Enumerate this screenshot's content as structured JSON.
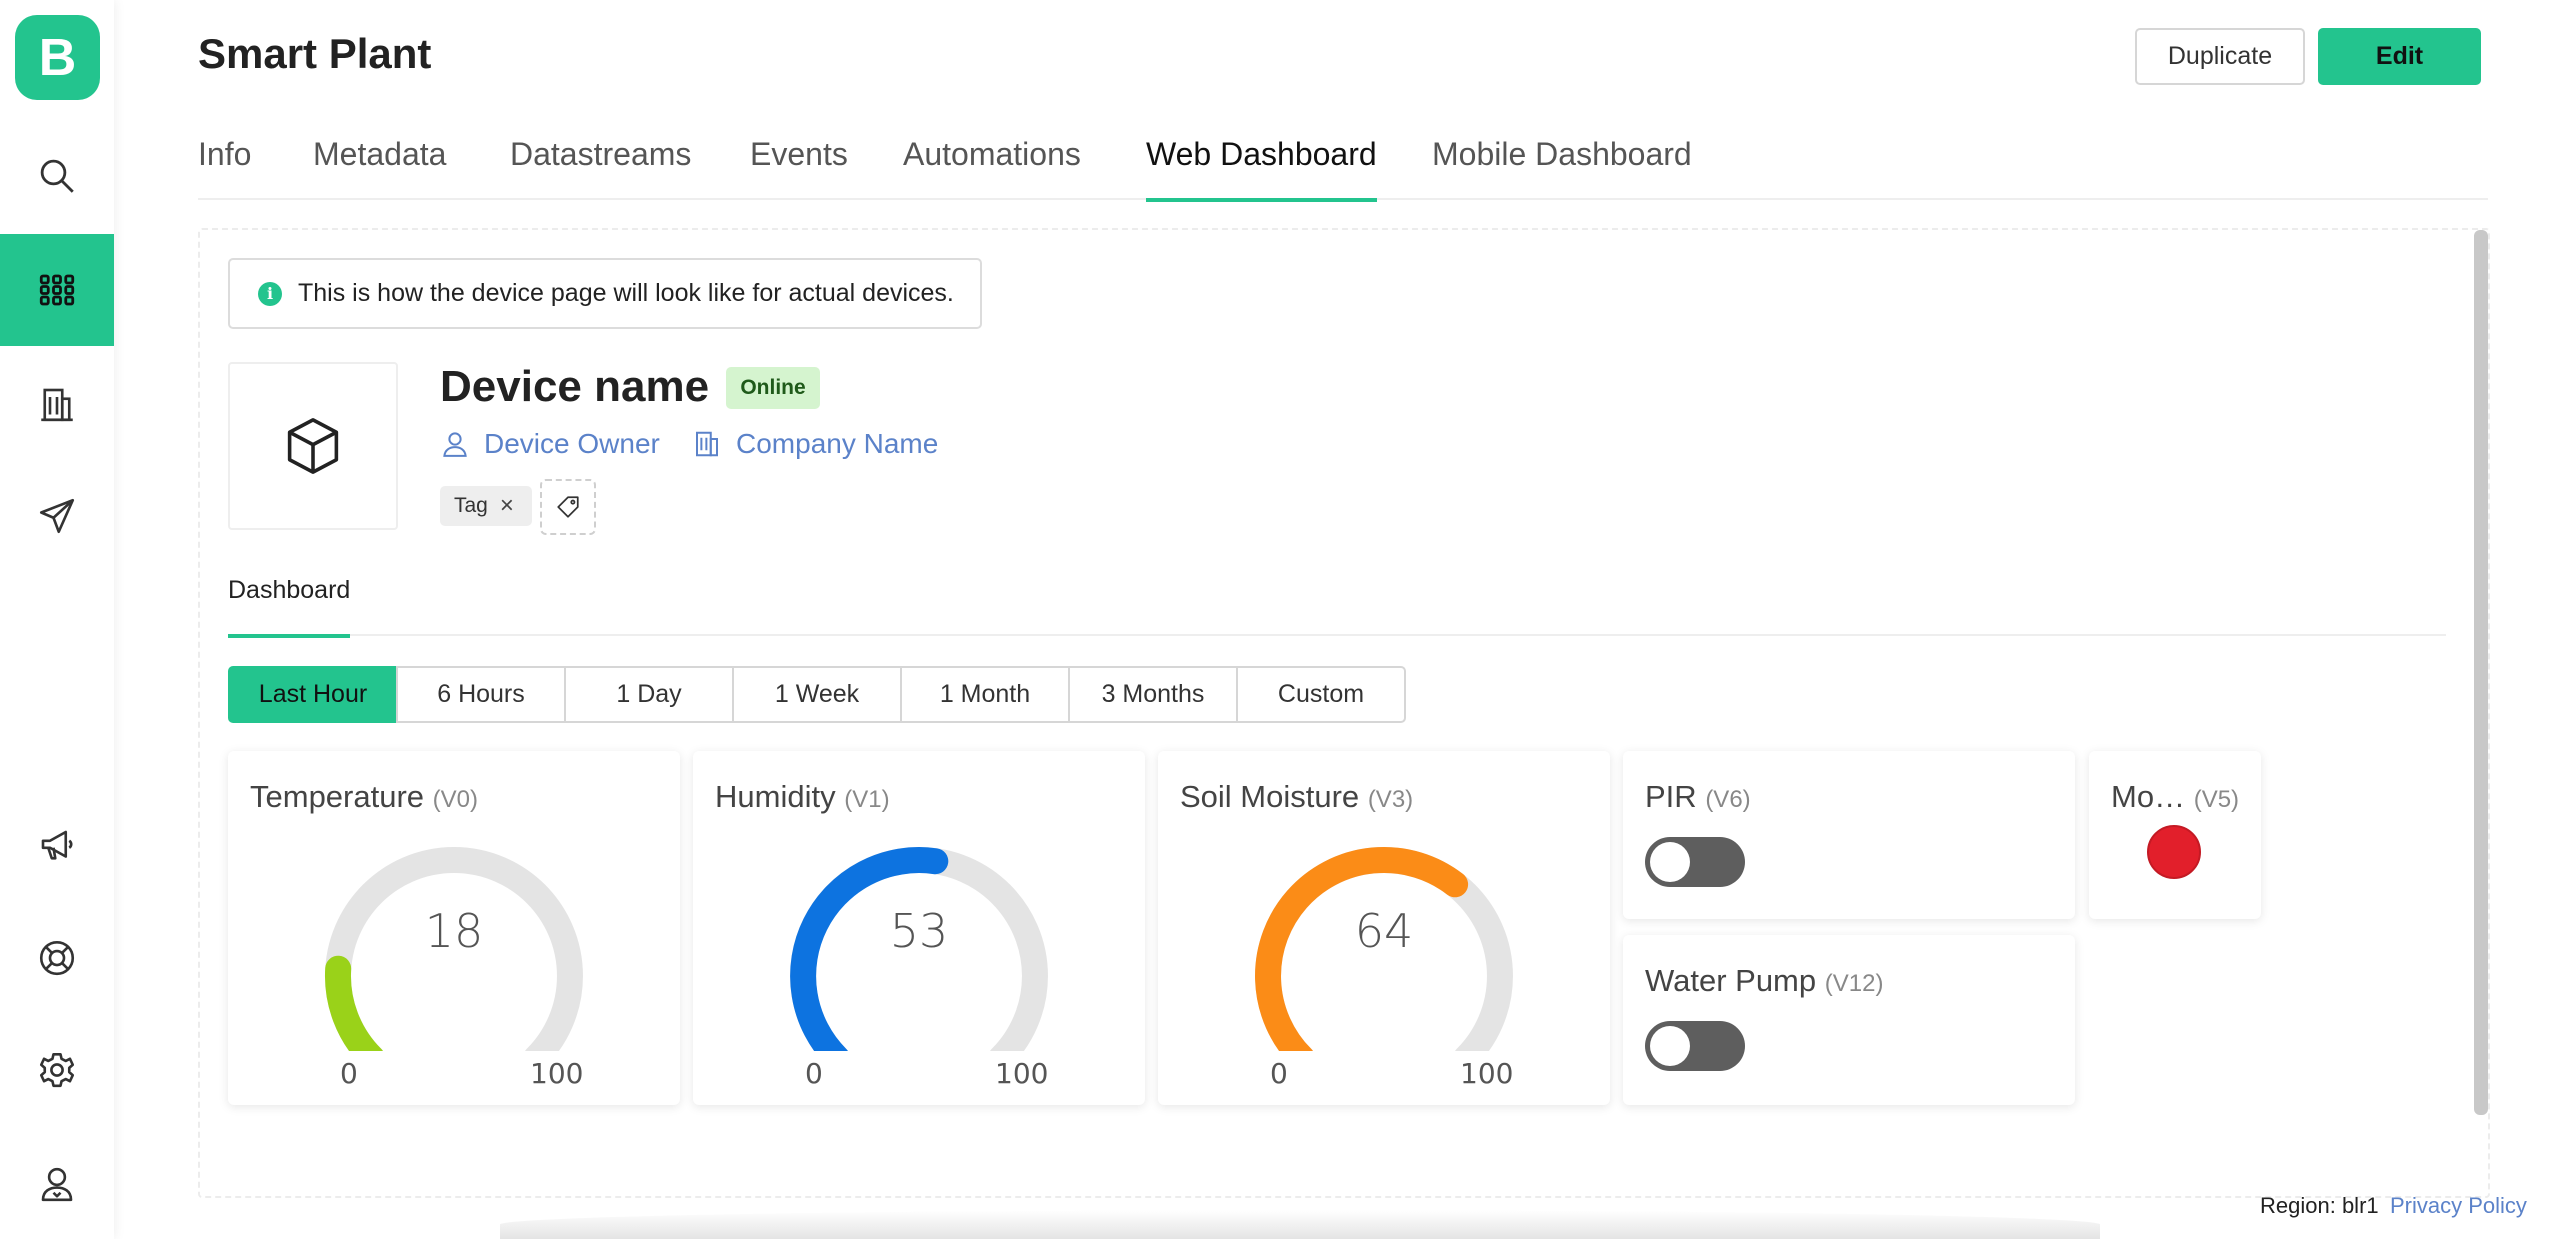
{
  "app": {
    "logo_letter": "B"
  },
  "header": {
    "title": "Smart Plant",
    "duplicate_label": "Duplicate",
    "edit_label": "Edit"
  },
  "tabs": [
    {
      "label": "Info"
    },
    {
      "label": "Metadata"
    },
    {
      "label": "Datastreams"
    },
    {
      "label": "Events"
    },
    {
      "label": "Automations"
    },
    {
      "label": "Web Dashboard",
      "active": true
    },
    {
      "label": "Mobile Dashboard"
    }
  ],
  "notice": {
    "icon": "info-icon",
    "glyph": "i",
    "text": "This is how the device page will look like for actual devices."
  },
  "device": {
    "name": "Device name",
    "status": "Online",
    "owner": "Device Owner",
    "company": "Company Name",
    "tag": "Tag",
    "tag_remove": "×"
  },
  "dashboard_tab": "Dashboard",
  "time_ranges": [
    {
      "label": "Last Hour",
      "active": true
    },
    {
      "label": "6 Hours"
    },
    {
      "label": "1 Day"
    },
    {
      "label": "1 Week"
    },
    {
      "label": "1 Month"
    },
    {
      "label": "3 Months"
    },
    {
      "label": "Custom"
    }
  ],
  "widgets": {
    "temperature": {
      "title": "Temperature",
      "pin": "(V0)",
      "value": 18,
      "min": 0,
      "max": 100,
      "color": "#9ad219"
    },
    "humidity": {
      "title": "Humidity",
      "pin": "(V1)",
      "value": 53,
      "min": 0,
      "max": 100,
      "color": "#0d73e0"
    },
    "soil": {
      "title": "Soil Moisture",
      "pin": "(V3)",
      "value": 64,
      "min": 0,
      "max": 100,
      "color": "#fb8c17"
    },
    "pir": {
      "title": "PIR",
      "pin": "(V6)",
      "state": "off"
    },
    "pump": {
      "title": "Water Pump",
      "pin": "(V12)",
      "state": "off"
    },
    "motion": {
      "title": "Mo…",
      "pin": "(V5)",
      "led_color": "#e21f2b"
    }
  },
  "footer": {
    "region": "Region: blr1",
    "privacy": "Privacy Policy"
  },
  "colors": {
    "accent": "#23c48e",
    "link": "#5b82c9",
    "track": "#e4e4e4"
  }
}
